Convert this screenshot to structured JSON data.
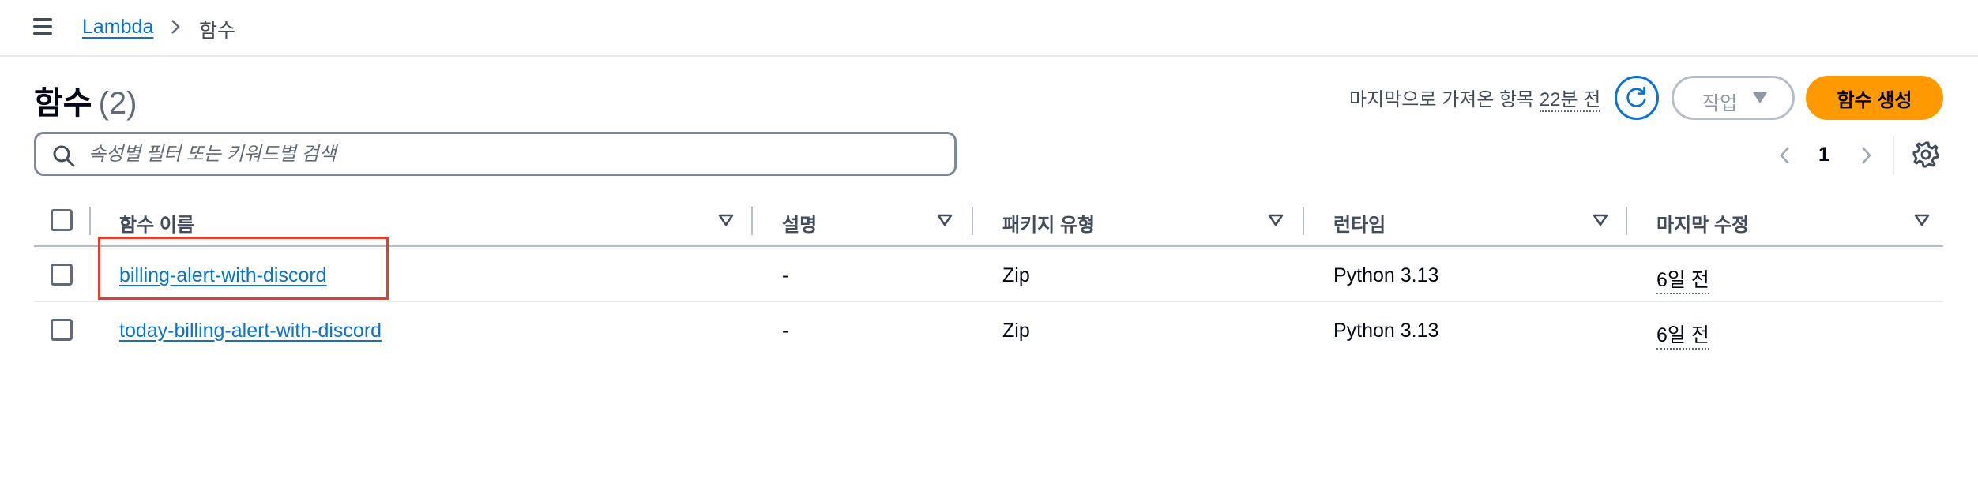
{
  "breadcrumb": {
    "root_label": "Lambda",
    "current_label": "함수"
  },
  "header": {
    "title": "함수",
    "count": "(2)",
    "last_fetched_prefix": "마지막으로 가져온 항목",
    "last_fetched_time": "22분 전",
    "actions_label": "작업",
    "create_label": "함수 생성"
  },
  "search": {
    "placeholder": "속성별 필터 또는 키워드별 검색",
    "value": ""
  },
  "pagination": {
    "current_page": "1"
  },
  "table": {
    "columns": [
      "함수 이름",
      "설명",
      "패키지 유형",
      "런타임",
      "마지막 수정"
    ],
    "rows": [
      {
        "name": "billing-alert-with-discord",
        "description": "-",
        "package_type": "Zip",
        "runtime": "Python 3.13",
        "last_modified": "6일 전"
      },
      {
        "name": "today-billing-alert-with-discord",
        "description": "-",
        "package_type": "Zip",
        "runtime": "Python 3.13",
        "last_modified": "6일 전"
      }
    ]
  },
  "colors": {
    "link": "#0972d3",
    "primary_button": "#ff9900",
    "highlight": "#e53e2d"
  },
  "icons": {
    "menu": "hamburger-menu-icon",
    "breadcrumb_separator": "chevron-right-icon",
    "refresh": "refresh-icon",
    "actions_dropdown": "caret-down-icon",
    "search": "search-icon",
    "prev_page": "chevron-left-icon",
    "next_page": "chevron-right-icon",
    "settings": "gear-icon",
    "sort": "sort-caret-icon"
  }
}
